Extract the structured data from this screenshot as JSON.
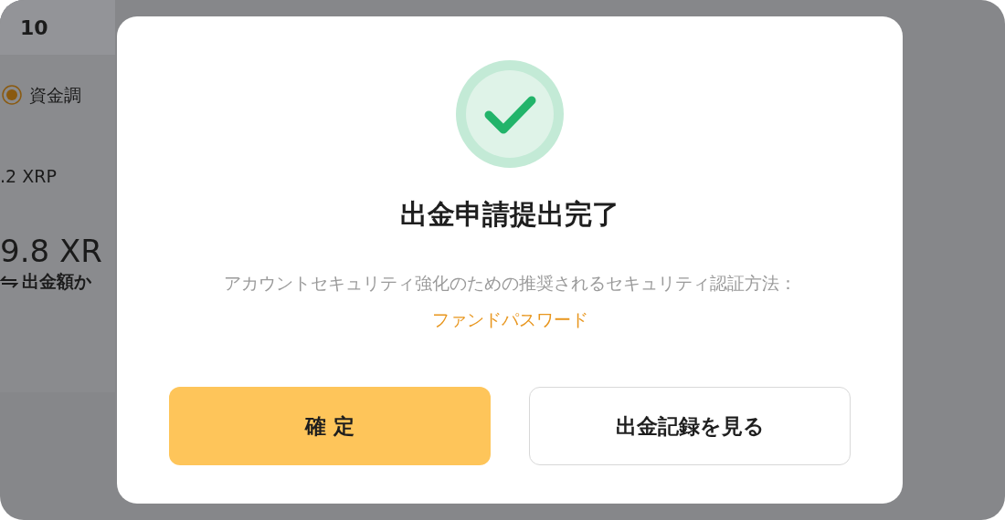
{
  "background": {
    "amount": "10",
    "radio": {
      "label": "資金調",
      "selected": true
    },
    "fee": ".2 XRP",
    "total": "9.8 XR",
    "note": "出金額か"
  },
  "dialog": {
    "title": "出金申請提出完了",
    "message": "アカウントセキュリティ強化のための推奨されるセキュリティ認証方法：",
    "link": "ファンドパスワード",
    "buttons": [
      {
        "label": "確 定",
        "kind": "primary"
      },
      {
        "label": "出金記録を見る",
        "kind": "secondary"
      }
    ]
  }
}
